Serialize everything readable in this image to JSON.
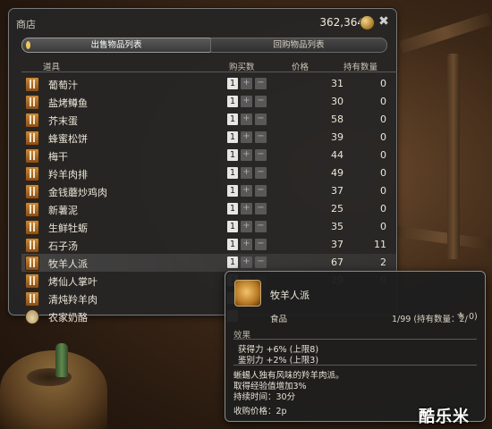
{
  "shop": {
    "title": "商店",
    "gil": "362,364",
    "tabs": {
      "sell": "出售物品列表",
      "buyback": "回购物品列表"
    },
    "columns": {
      "item": "道具",
      "buy_qty": "购买数",
      "price": "价格",
      "owned": "持有数量"
    },
    "items": [
      {
        "name": "葡萄汁",
        "qty": "1",
        "price": "31",
        "owned": "0"
      },
      {
        "name": "盐烤鳟鱼",
        "qty": "1",
        "price": "30",
        "owned": "0"
      },
      {
        "name": "芥末蛋",
        "qty": "1",
        "price": "58",
        "owned": "0"
      },
      {
        "name": "蜂蜜松饼",
        "qty": "1",
        "price": "39",
        "owned": "0"
      },
      {
        "name": "梅干",
        "qty": "1",
        "price": "44",
        "owned": "0"
      },
      {
        "name": "羚羊肉排",
        "qty": "1",
        "price": "49",
        "owned": "0"
      },
      {
        "name": "金钱蘑炒鸡肉",
        "qty": "1",
        "price": "37",
        "owned": "0"
      },
      {
        "name": "新薯泥",
        "qty": "1",
        "price": "25",
        "owned": "0"
      },
      {
        "name": "生鲜牡蛎",
        "qty": "1",
        "price": "35",
        "owned": "0"
      },
      {
        "name": "石子汤",
        "qty": "1",
        "price": "37",
        "owned": "11"
      },
      {
        "name": "牧羊人派",
        "qty": "1",
        "price": "67",
        "owned": "2"
      },
      {
        "name": "烤仙人掌叶",
        "qty": "1",
        "price": "29",
        "owned": "0"
      },
      {
        "name": "清炖羚羊肉",
        "qty": "",
        "price": "",
        "owned": ""
      },
      {
        "name": "农家奶酪",
        "qty": "",
        "price": "",
        "owned": ""
      }
    ]
  },
  "tooltip": {
    "name": "牧羊人派",
    "category": "食品",
    "stack": "1/99 (持有数量：2/",
    "stack_tail": "0)",
    "effects_header": "效果",
    "effects": [
      "获得力 +6% (上限8)",
      "鉴别力 +2% (上限3)"
    ],
    "description": [
      "蜥蜴人独有风味的羚羊肉派。",
      "取得经验值增加3%",
      "持续时间：30分"
    ],
    "sell_price": "收购价格：2p"
  },
  "watermark": "酷乐米"
}
